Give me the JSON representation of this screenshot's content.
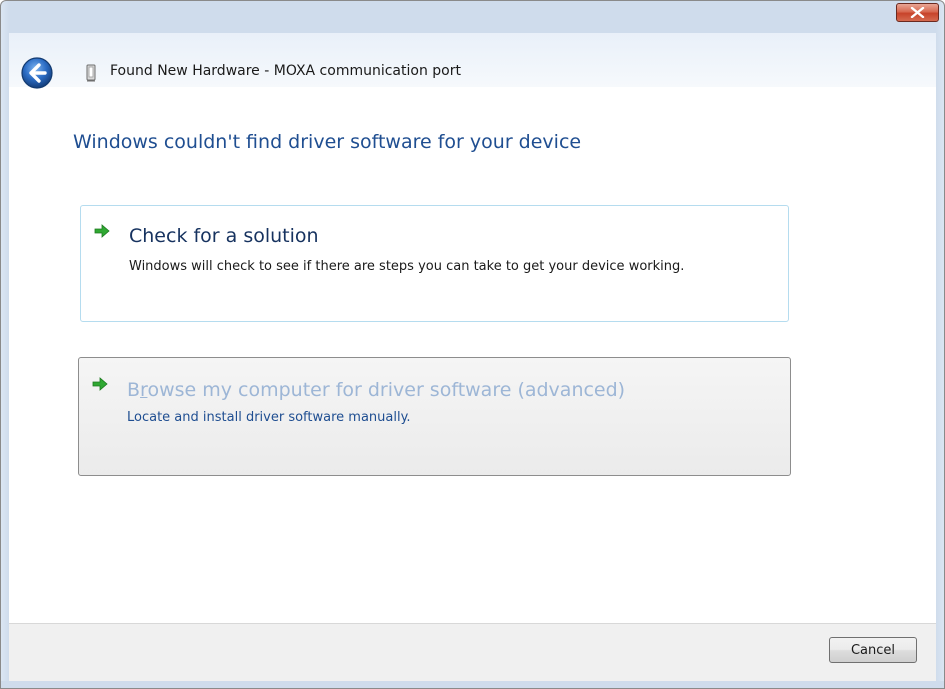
{
  "window": {
    "title": "Found New Hardware - MOXA communication port"
  },
  "main": {
    "heading": "Windows couldn't find driver software for your device",
    "options": [
      {
        "title": "Check for a solution",
        "description": "Windows will check to see if there are steps you can take to get your device working."
      },
      {
        "title_pre": "B",
        "title_accel": "r",
        "title_post": "owse my computer for driver software (advanced)",
        "description": "Locate and install driver software manually."
      }
    ]
  },
  "footer": {
    "cancel_label": "Cancel"
  },
  "colors": {
    "heading": "#1f4e91",
    "arrow": "#2fa832",
    "close_button": "#c7432a"
  }
}
